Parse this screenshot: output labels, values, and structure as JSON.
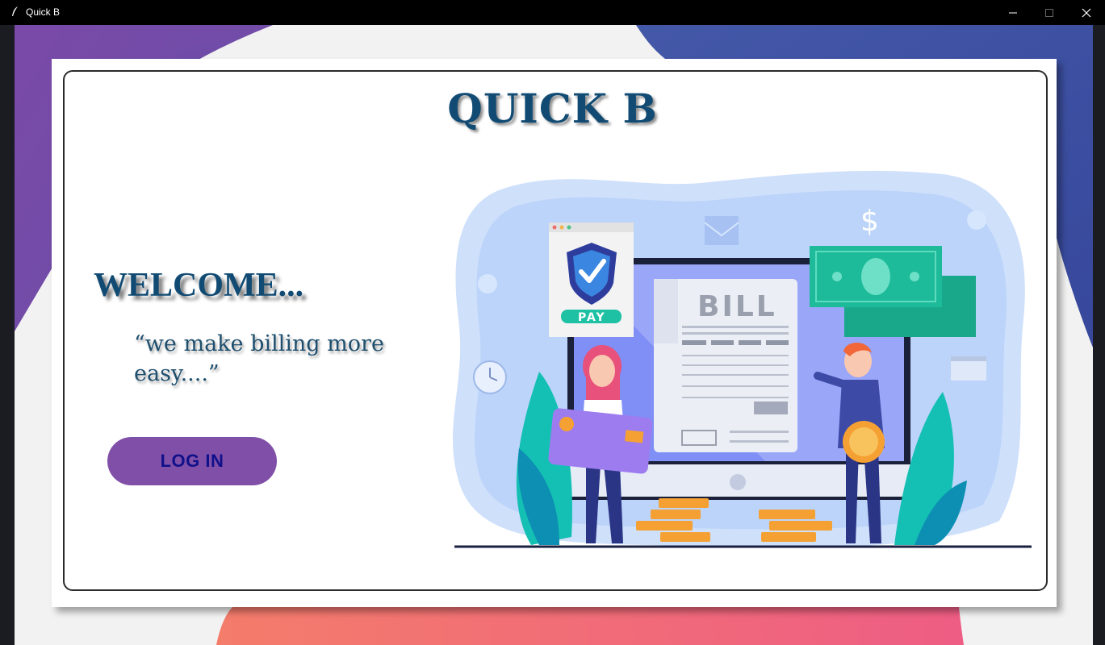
{
  "window": {
    "title": "Quick B"
  },
  "app": {
    "title": "QUICK B",
    "welcome": "WELCOME...",
    "tagline": "“we make billing more easy....”",
    "login_label": "LOG IN"
  },
  "illustration": {
    "bill_text": "BILL",
    "pay_text": "PAY",
    "dollar_text": "$"
  },
  "colors": {
    "title_text": "#114b73",
    "button_bg": "#8050a8",
    "button_text": "#10108a",
    "bg_purple": "#7b4fa8",
    "bg_blue": "#3f57a5",
    "bg_pink": "#f2707a"
  }
}
